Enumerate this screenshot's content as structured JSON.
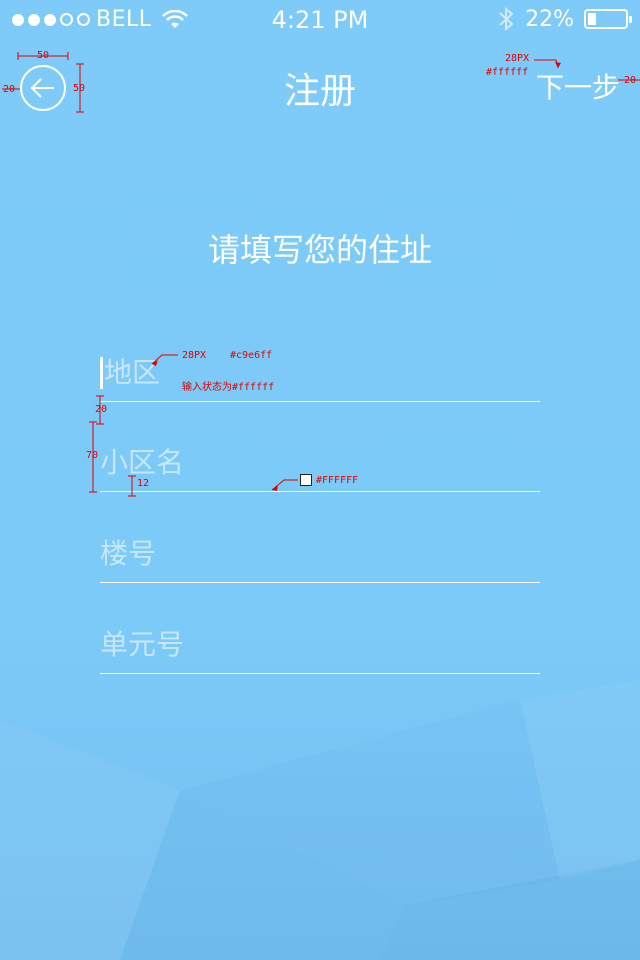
{
  "status_bar": {
    "carrier": "BELL",
    "time": "4:21 PM",
    "battery_percent": "22%",
    "battery_level": 0.22,
    "signal_bars": 3,
    "signal_total": 5
  },
  "nav": {
    "title": "注册",
    "next_label": "下一步",
    "back_icon": "arrow-left-circle-icon"
  },
  "page": {
    "subtitle": "请填写您的住址"
  },
  "form": {
    "fields": [
      {
        "placeholder": "地区",
        "active": true
      },
      {
        "placeholder": "小区名"
      },
      {
        "placeholder": "楼号"
      },
      {
        "placeholder": "单元号"
      }
    ]
  },
  "annotations": {
    "back_w": "50",
    "back_h": "50",
    "back_margin": "20",
    "next_size": "28PX",
    "next_color": "#ffffff",
    "next_margin": "20",
    "field_size": "28PX",
    "field_color": "#c9e6ff",
    "field_active_note": "输入状态为#ffffff",
    "field_spacing": "20",
    "field_height": "70",
    "line_gap": "12",
    "line_color": "#FFFFFF"
  },
  "colors": {
    "background": "#7ECBF9",
    "text": "#ffffff",
    "placeholder": "#c9e6ff",
    "annotation": "#e00000"
  }
}
